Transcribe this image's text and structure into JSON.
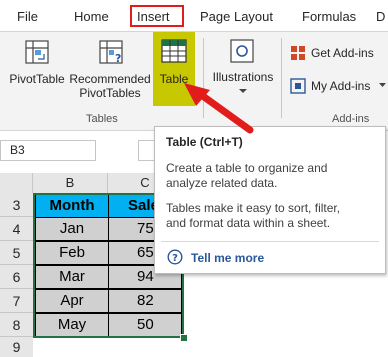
{
  "tabs": [
    "File",
    "Home",
    "Insert",
    "Page Layout",
    "Formulas",
    "D"
  ],
  "ribbon": {
    "pivottable": "PivotTable",
    "recommended_line1": "Recommended",
    "recommended_line2": "PivotTables",
    "table": "Table",
    "illustrations": "Illustrations",
    "get_addins": "Get Add-ins",
    "my_addins": "My Add-ins",
    "group_tables": "Tables",
    "group_addins": "Add-ins"
  },
  "namebox": "B3",
  "columns": [
    "B",
    "C"
  ],
  "rows": [
    "3",
    "4",
    "5",
    "6",
    "7",
    "8",
    "9"
  ],
  "table": {
    "headers": [
      "Month",
      "Sale"
    ],
    "rows": [
      {
        "month": "Jan",
        "sale": "75"
      },
      {
        "month": "Feb",
        "sale": "65"
      },
      {
        "month": "Mar",
        "sale": "94"
      },
      {
        "month": "Apr",
        "sale": "82"
      },
      {
        "month": "May",
        "sale": "50"
      }
    ]
  },
  "tooltip": {
    "title": "Table (Ctrl+T)",
    "desc1_line1": "Create a table to organize and",
    "desc1_line2": "analyze related data.",
    "desc2_line1": "Tables make it easy to sort, filter,",
    "desc2_line2": "and format data within a sheet.",
    "link": "Tell me more"
  },
  "colors": {
    "highlight": "#c8c800",
    "header_fill": "#00b0f0",
    "data_fill": "#d0d0d0",
    "callout_red": "#e21b1b",
    "accent_green": "#217346"
  }
}
